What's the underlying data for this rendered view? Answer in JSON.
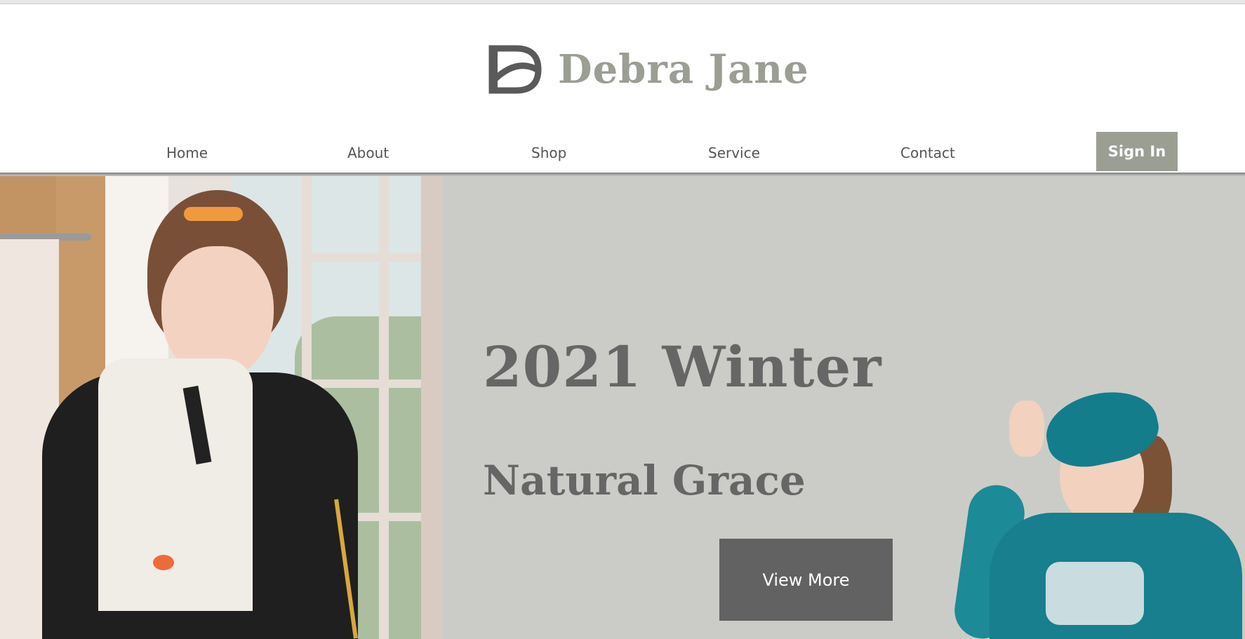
{
  "brand": {
    "name": "Debra Jane"
  },
  "nav": {
    "items": [
      {
        "label": "Home"
      },
      {
        "label": "About"
      },
      {
        "label": "Shop"
      },
      {
        "label": "Service"
      },
      {
        "label": "Contact"
      }
    ],
    "sign_in_label": "Sign In"
  },
  "hero": {
    "title": "2021 Winter",
    "subtitle": "Natural Grace",
    "cta_label": "View More"
  },
  "colors": {
    "brand_gray_green": "#9a9e93",
    "hero_background": "#cbccc7",
    "cta_background": "#626262",
    "heading_text": "#666666"
  }
}
